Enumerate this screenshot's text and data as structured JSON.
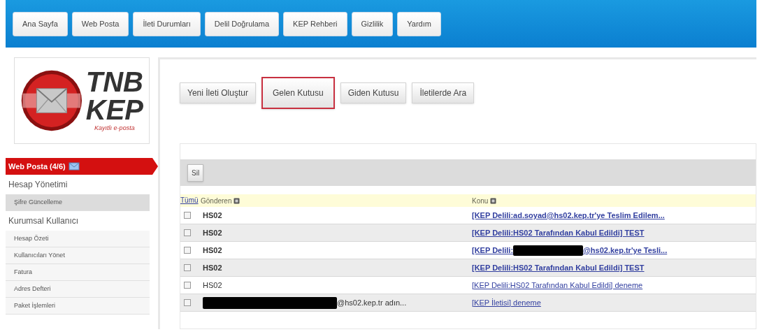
{
  "top_nav": [
    {
      "label": "Ana Sayfa"
    },
    {
      "label": "Web Posta"
    },
    {
      "label": "İleti Durumları"
    },
    {
      "label": "Delil Doğrulama"
    },
    {
      "label": "KEP Rehberi"
    },
    {
      "label": "Gizlilik"
    },
    {
      "label": "Yardım"
    }
  ],
  "logo": {
    "line1": "TNB",
    "line2": "KEP",
    "tagline": "Kayıtlı e-posta"
  },
  "sidebar": {
    "active": "Web Posta (4/6)",
    "groups": [
      {
        "title": "Hesap Yönetimi",
        "items": [
          {
            "label": "Şifre Güncelleme",
            "selected": true
          }
        ]
      },
      {
        "title": "Kurumsal Kullanıcı",
        "items": [
          {
            "label": "Hesap Özeti",
            "selected": false
          },
          {
            "label": "Kullanıcıları Yönet",
            "selected": false
          },
          {
            "label": "Fatura",
            "selected": false
          },
          {
            "label": "Adres Defteri",
            "selected": false
          },
          {
            "label": "Paket İşlemleri",
            "selected": false
          }
        ]
      }
    ]
  },
  "mail_tabs": [
    {
      "label": "Yeni İleti Oluştur",
      "selected": false
    },
    {
      "label": "Gelen Kutusu",
      "selected": true
    },
    {
      "label": "Giden Kutusu",
      "selected": false
    },
    {
      "label": "İletilerde Ara",
      "selected": false
    }
  ],
  "toolbar": {
    "delete_button": "Sil"
  },
  "table": {
    "select_all": "Tümü",
    "columns": [
      "Gönderen",
      "Konu"
    ],
    "rows": [
      {
        "sender": "HS02",
        "sender_redacted": false,
        "subject": "[KEP Delili:ad.soyad@hs02.kep.tr'ye Teslim Edilem...",
        "subject_redacted": false,
        "unread": true,
        "checked": false
      },
      {
        "sender": "HS02",
        "sender_redacted": false,
        "subject": "[KEP Delili:HS02 Tarafından Kabul Edildi] TEST",
        "subject_redacted": false,
        "unread": true,
        "checked": false
      },
      {
        "sender": "HS02",
        "sender_redacted": false,
        "subject_prefix": "[KEP Delili:",
        "subject": "@hs02.kep.tr'ye Tesli...",
        "subject_redacted": true,
        "unread": true,
        "checked": false
      },
      {
        "sender": "HS02",
        "sender_redacted": false,
        "subject": "[KEP Delili:HS02 Tarafından Kabul Edildi] TEST",
        "subject_redacted": false,
        "unread": true,
        "checked": false
      },
      {
        "sender": "HS02",
        "sender_redacted": false,
        "subject": "[KEP Delili:HS02 Tarafından Kabul Edildi] deneme",
        "subject_redacted": false,
        "unread": false,
        "checked": false
      },
      {
        "sender": "@hs02.kep.tr adın...",
        "sender_redacted": true,
        "subject": "[KEP İletisi] deneme",
        "subject_redacted": false,
        "unread": false,
        "checked": false
      }
    ]
  }
}
